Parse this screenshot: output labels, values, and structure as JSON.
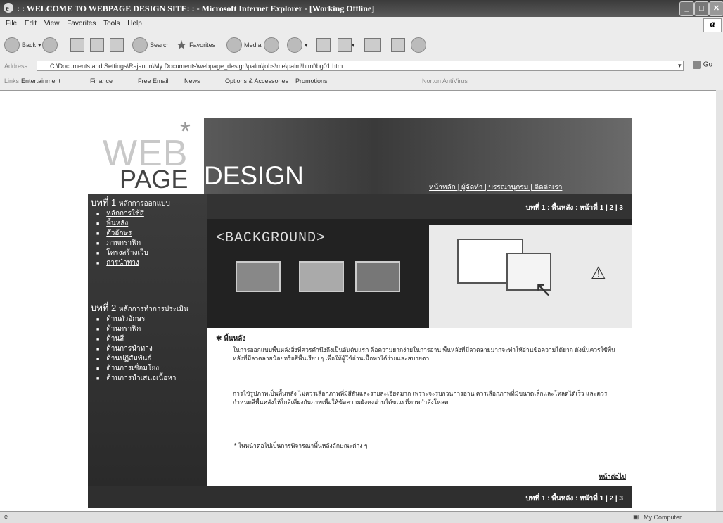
{
  "window": {
    "title": ": : WELCOME TO WEBPAGE DESIGN SITE: : - Microsoft Internet Explorer - [Working Offline]",
    "throbber": "a"
  },
  "menu": [
    "File",
    "Edit",
    "View",
    "Favorites",
    "Tools",
    "Help"
  ],
  "toolbar": {
    "back": "Back",
    "search": "Search",
    "favorites": "Favorites",
    "media": "Media"
  },
  "address": {
    "label": "Address",
    "value": "C:\\Documents and Settings\\Rajanun\\My Documents\\webpage_design\\palm\\jobs\\me\\palm\\html\\bg01.htm",
    "go": "Go"
  },
  "links": {
    "label": "Links",
    "items": [
      "Entertainment",
      "Finance",
      "Free Email",
      "News",
      "Options & Accessories",
      "Promotions"
    ],
    "norton": "Norton AntiVirus"
  },
  "page": {
    "logo_web": "WEB",
    "logo_star": "*",
    "logo_page": "PAGE",
    "logo_design": "DESIGN",
    "top_nav": "หน้าหลัก | ผู้จัดทำ | บรรณานุกรม | ติดต่อเรา",
    "breadcrumb": "บทที่ 1 : พื้นหลัง : หน้าที่ 1 | 2 | 3",
    "hero_text": "<BACKGROUND>",
    "chapter1": {
      "num": "บทที่ 1",
      "title": "หลักการออกแบบ",
      "items": [
        "หลักการใช้สี",
        "พื้นหลัง",
        "ตัวอักษร",
        "ภาพกราฟิก",
        "โครงสร้างเว็บ",
        "การนำทาง"
      ]
    },
    "chapter2": {
      "num": "บทที่ 2",
      "title": "หลักการทำการประเมิน",
      "items": [
        "ด้านตัวอักษร",
        "ด้านกราฟิก",
        "ด้านสี",
        "ด้านการนำทาง",
        "ด้านปฏิสัมพันธ์",
        "ด้านการเชื่อมโยง",
        "ด้านการนำเสนอเนื้อหา"
      ]
    },
    "panel_title": "พื้นหลัง",
    "para1": "ในการออกแบบพื้นหลังสิ่งที่ควรคำนึงถึงเป็นอันดับแรก คือความยากง่ายในการอ่าน พื้นหลังที่มีลวดลายมากจะทำให้อ่านข้อความได้ยาก ดังนั้นควรใช้พื้นหลังที่มีลวดลายน้อยหรือสีพื้นเรียบ ๆ เพื่อให้ผู้ใช้อ่านเนื้อหาได้ง่ายและสบายตา",
    "para2": "การใช้รูปภาพเป็นพื้นหลัง ไม่ควรเลือกภาพที่มีสีสันและรายละเอียดมาก เพราะจะรบกวนการอ่าน ควรเลือกภาพที่มีขนาดเล็กและโหลดได้เร็ว และควรกำหนดสีพื้นหลังให้ใกล้เคียงกับภาพเพื่อให้ข้อความยังคงอ่านได้ขณะที่ภาพกำลังโหลด",
    "note": "* ในหน้าต่อไปเป็นการพิจารณาพื้นหลังลักษณะต่าง ๆ",
    "next": "หน้าต่อไป",
    "footer_breadcrumb": "บทที่ 1 : พื้นหลัง : หน้าที่ 1 | 2 | 3"
  },
  "status": {
    "zone": "My Computer"
  }
}
